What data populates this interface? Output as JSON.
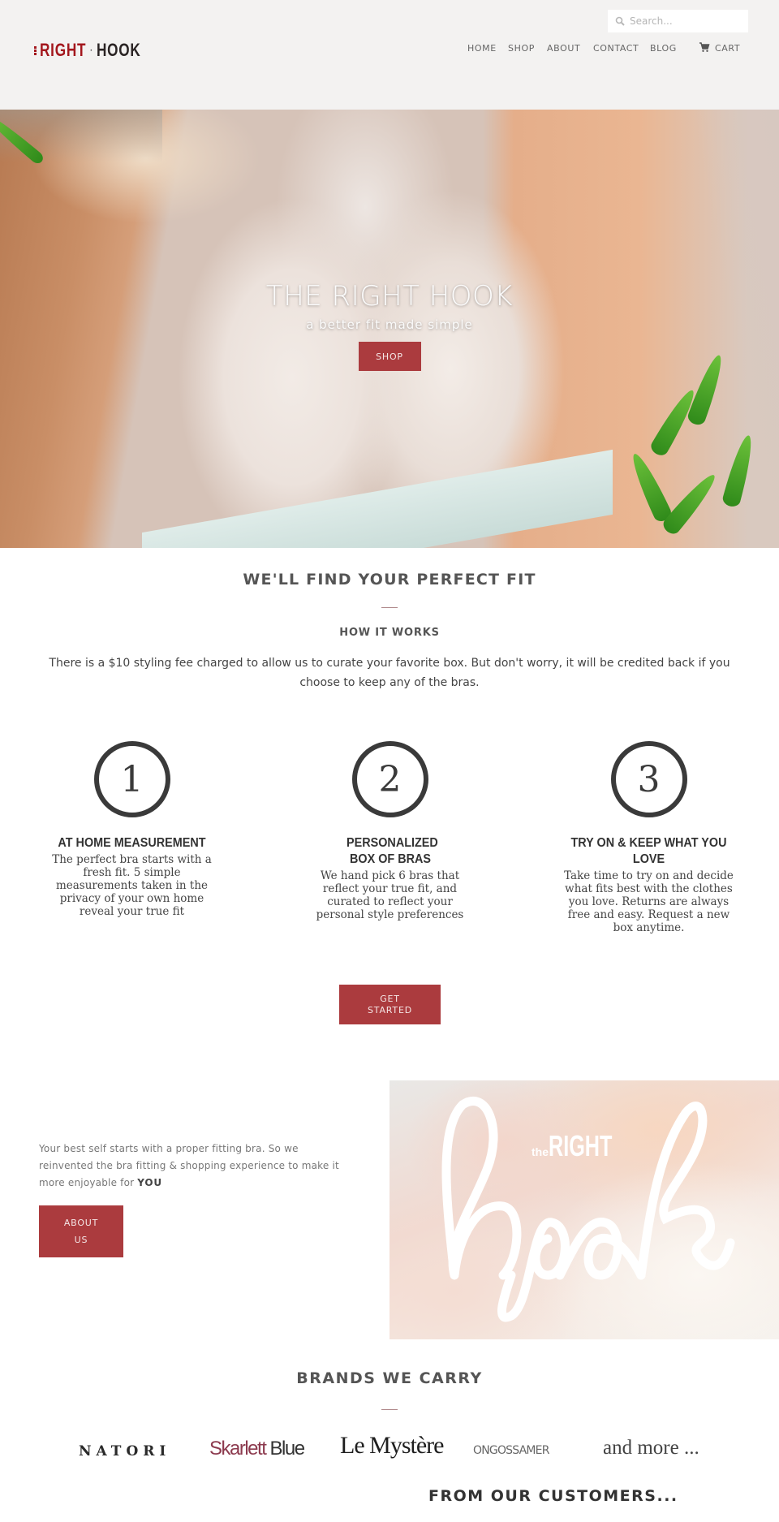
{
  "header": {
    "logo": {
      "the": "the",
      "right": "RIGHT",
      "separator": "·",
      "hook": "HOOK"
    },
    "search": {
      "placeholder": "Search...",
      "value": "",
      "icon": "search-icon"
    },
    "nav": [
      {
        "label": "HOME"
      },
      {
        "label": "SHOP"
      },
      {
        "label": "ABOUT"
      },
      {
        "label": "CONTACT"
      },
      {
        "label": "BLOG"
      }
    ],
    "cart": {
      "label": "CART",
      "icon": "cart-icon"
    }
  },
  "hero": {
    "title": "THE RIGHT HOOK",
    "tagline": "a better fit made simple",
    "button": "SHOP"
  },
  "fit": {
    "title": "WE'LL FIND YOUR PERFECT FIT",
    "subtitle": "HOW IT WORKS",
    "fee_text": "There is a $10 styling fee charged to allow us to curate your favorite box. But don't worry, it will be credited back if you choose to keep any of the bras.",
    "steps": [
      {
        "number": "1",
        "title": "AT HOME MEASUREMENT",
        "text": "The perfect bra starts with a fresh fit. 5 simple measurements taken in the privacy of your own home reveal your true fit"
      },
      {
        "number": "2",
        "title": "PERSONALIZED BOX OF BRAS",
        "text": "We hand pick 6 bras that reflect your true fit, and curated to reflect your personal style preferences"
      },
      {
        "number": "3",
        "title": "TRY ON & KEEP WHAT YOU LOVE",
        "text": "Take time to try on and decide what fits best with the clothes you love. Returns are always free and easy. Request a new box anytime."
      }
    ],
    "button": "GET STARTED"
  },
  "about": {
    "text": "Your best self starts with a proper fitting bra. So we reinvented the bra fitting & shopping experience to make it more enjoyable for",
    "emphasis": "YOU",
    "button": "ABOUT US",
    "image_logo": {
      "the": "the",
      "right": "RIGHT",
      "script": "hook"
    }
  },
  "brands": {
    "title": "BRANDS WE CARRY",
    "items": [
      {
        "name": "NATORI"
      },
      {
        "name": "Skarlett Blue",
        "part1": "Skarlett",
        "part2": "Blue"
      },
      {
        "name": "Le Mystère"
      },
      {
        "name": "ON GOSSAMER",
        "display": "ONGOSSAMER"
      },
      {
        "name": "and more ..."
      }
    ]
  },
  "customers": {
    "title": "FROM OUR CUSTOMERS..."
  },
  "colors": {
    "accent": "#ab3b3e",
    "logo_red": "#a3171d",
    "header_bg": "#f3f2f1",
    "text_dark": "#444444"
  }
}
